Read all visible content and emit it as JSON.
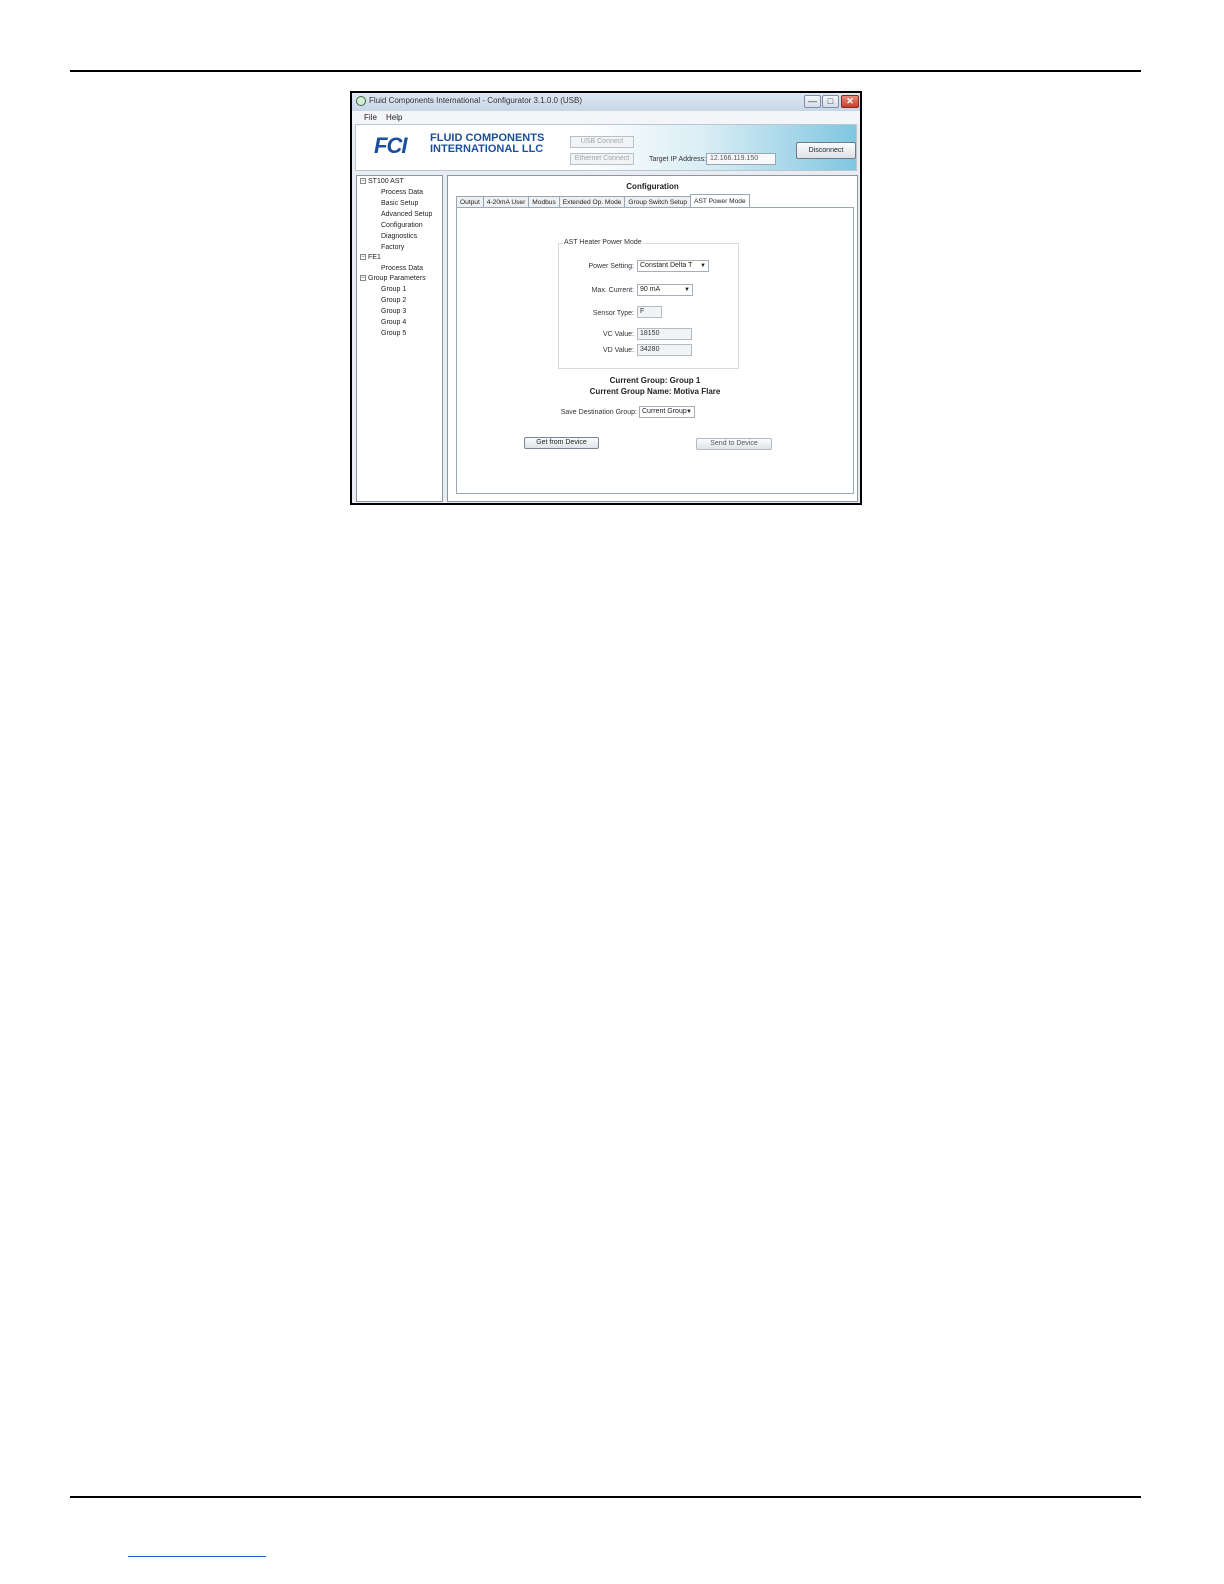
{
  "window": {
    "title": "Fluid Components International - Configurator 3.1.0.0 (USB)",
    "controls": {
      "minimize": "—",
      "maximize": "□",
      "close": "✕"
    }
  },
  "menu": {
    "file": "File",
    "help": "Help"
  },
  "header": {
    "logo_mark": "FCI",
    "logo_line1": "FLUID COMPONENTS",
    "logo_line2": "INTERNATIONAL LLC",
    "usb_connect": "USB Connect",
    "ethernet_connect": "Ethernet Connect",
    "target_ip_label": "Target IP Address:",
    "target_ip_value": "12.166.119.150",
    "disconnect": "Disconnect"
  },
  "tree": {
    "st100": "ST100 AST",
    "st100_items": [
      "Process Data",
      "Basic Setup",
      "Advanced Setup",
      "Configuration",
      "Diagnostics",
      "Factory"
    ],
    "fe1": "FE1",
    "fe1_items": [
      "Process Data"
    ],
    "group_params": "Group Parameters",
    "group_items": [
      "Group 1",
      "Group 2",
      "Group 3",
      "Group 4",
      "Group 5"
    ]
  },
  "main": {
    "title": "Configuration",
    "tabs": [
      "Output",
      "4-20mA User",
      "Modbus",
      "Extended Op. Mode",
      "Group Switch Setup",
      "AST Power Mode"
    ],
    "active_tab": "AST Power Mode",
    "group_box_label": "AST Heater Power Mode",
    "power_setting_label": "Power Setting:",
    "power_setting_value": "Constant Delta T",
    "max_current_label": "Max. Current:",
    "max_current_value": "90 mA",
    "sensor_type_label": "Sensor Type:",
    "sensor_type_value": "F",
    "vc_label": "VC Value:",
    "vc_value": "18150",
    "vd_label": "VD Value:",
    "vd_value": "34280",
    "current_group": "Current Group: Group 1",
    "current_group_name": "Current Group Name: Motiva Flare",
    "save_dest_label": "Save Destination Group:",
    "save_dest_value": "Current Group",
    "get_button": "Get from Device",
    "send_button": "Send to Device"
  }
}
